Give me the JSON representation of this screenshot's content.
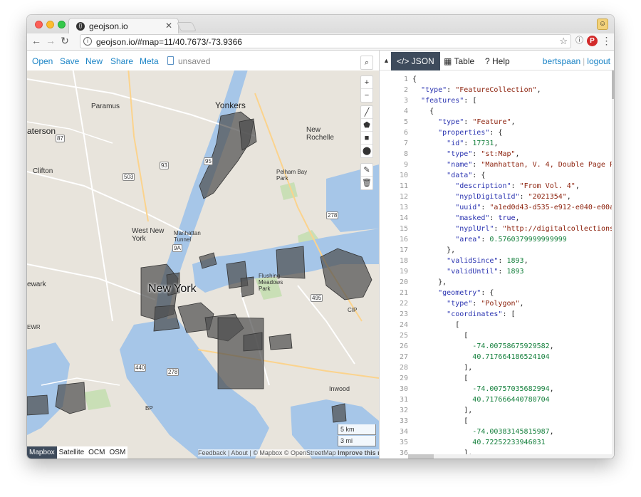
{
  "browser": {
    "tab_title": "geojson.io",
    "favicon_text": "{}",
    "url": "geojson.io/#map=11/40.7673/-73.9366"
  },
  "app_menu": {
    "open": "Open",
    "save": "Save",
    "new": "New",
    "share": "Share",
    "meta": "Meta",
    "status": "unsaved"
  },
  "map": {
    "labels": {
      "yonkers": "Yonkers",
      "paramus": "Paramus",
      "paterson": "aterson",
      "new_rochelle": "New\nRochelle",
      "clifton": "Clifton",
      "west_new_york": "West New\nYork",
      "manhattan_tunnel": "Manhattan\nTunnel",
      "new_york": "New York",
      "newark": "ewark",
      "pelham_bay": "Pelham Bay\nPark",
      "flushing": "Flushing\nMeadows\nPark",
      "inwood": "Inwood",
      "ewr": "EWR",
      "cip": "CIP",
      "bp": "BP"
    },
    "shields": [
      "87",
      "93",
      "503",
      "95",
      "278",
      "495",
      "440",
      "278",
      "9A"
    ],
    "scale_km": "5 km",
    "scale_mi": "3 mi",
    "layers": [
      "Mapbox",
      "Satellite",
      "OCM",
      "OSM"
    ],
    "active_layer": "Mapbox",
    "attribution": {
      "feedback": "Feedback",
      "about": "About",
      "copy": "© Mapbox © OpenStreetMap",
      "improve": "Improve this map"
    },
    "colors": {
      "water": "#a6c6e8",
      "land": "#e8e4dc",
      "park": "#c9dfb6",
      "polygon_fill": "#4d4d4d",
      "accent": "#3e4b5c",
      "link": "#1b84c6"
    }
  },
  "panel": {
    "tabs": [
      {
        "label": "</> JSON",
        "active": true
      },
      {
        "label": "Table",
        "active": false
      },
      {
        "label": "? Help",
        "active": false
      }
    ],
    "user": "bertspaan",
    "logout": "logout",
    "separator": "|"
  },
  "code_lines": [
    {
      "n": "1",
      "t": "{"
    },
    {
      "n": "2",
      "t": "  \"type\": \"FeatureCollection\","
    },
    {
      "n": "3",
      "t": "  \"features\": ["
    },
    {
      "n": "4",
      "t": "    {"
    },
    {
      "n": "5",
      "t": "      \"type\": \"Feature\","
    },
    {
      "n": "6",
      "t": "      \"properties\": {"
    },
    {
      "n": "7",
      "t": "        \"id\": 17731,"
    },
    {
      "n": "8",
      "t": "        \"type\": \"st:Map\","
    },
    {
      "n": "9",
      "t": "        \"name\": \"Manhattan, V. 4, Double Page P"
    },
    {
      "n": "10",
      "t": "        \"data\": {"
    },
    {
      "n": "11",
      "t": "          \"description\": \"From Vol. 4\","
    },
    {
      "n": "12",
      "t": "          \"nyplDigitalId\": \"2021354\","
    },
    {
      "n": "13",
      "t": "          \"uuid\": \"a1ed0d43-d535-e912-e040-e00a"
    },
    {
      "n": "14",
      "t": "          \"masked\": true,"
    },
    {
      "n": "15",
      "t": "          \"nyplUrl\": \"http://digitalcollections"
    },
    {
      "n": "16",
      "t": "          \"area\": 0.5760379999999999"
    },
    {
      "n": "17",
      "t": "        },"
    },
    {
      "n": "18",
      "t": "        \"validSince\": 1893,"
    },
    {
      "n": "19",
      "t": "        \"validUntil\": 1893"
    },
    {
      "n": "20",
      "t": "      },"
    },
    {
      "n": "21",
      "t": "      \"geometry\": {"
    },
    {
      "n": "22",
      "t": "        \"type\": \"Polygon\","
    },
    {
      "n": "23",
      "t": "        \"coordinates\": ["
    },
    {
      "n": "24",
      "t": "          ["
    },
    {
      "n": "25",
      "t": "            ["
    },
    {
      "n": "26",
      "t": "              -74.00758675929582,"
    },
    {
      "n": "27",
      "t": "              40.717664186524104"
    },
    {
      "n": "28",
      "t": "            ],"
    },
    {
      "n": "29",
      "t": "            ["
    },
    {
      "n": "30",
      "t": "              -74.00757035682994,"
    },
    {
      "n": "31",
      "t": "              40.717666440780704"
    },
    {
      "n": "32",
      "t": "            ],"
    },
    {
      "n": "33",
      "t": "            ["
    },
    {
      "n": "34",
      "t": "              -74.00383145815987,"
    },
    {
      "n": "35",
      "t": "              40.72252233946031"
    },
    {
      "n": "36",
      "t": "            ],"
    }
  ]
}
